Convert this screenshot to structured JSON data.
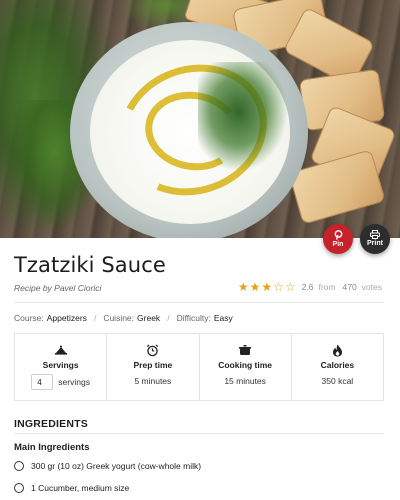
{
  "hero": {
    "alt_description": ""
  },
  "share": {
    "pin_label": "Pin",
    "pin_icon": "pinterest-icon",
    "print_label": "Print",
    "print_icon": "printer-icon",
    "pin_color": "#c7212b",
    "print_color": "#2d2d2d"
  },
  "recipe": {
    "title": "Tzatziki Sauce",
    "byline": "Recipe by Pavel Ciorici",
    "rating": {
      "value": 2.6,
      "value_text": "2.6",
      "from_text": "from",
      "votes_count": "470",
      "votes_text": "votes",
      "stars": [
        "full",
        "full",
        "full",
        "empty",
        "empty"
      ],
      "star_color": "#e6a117"
    },
    "meta": {
      "course_key": "Course:",
      "course_value": "Appetizers",
      "cuisine_key": "Cuisine:",
      "cuisine_value": "Greek",
      "difficulty_key": "Difficulty:",
      "difficulty_value": "Easy",
      "separator": "/"
    },
    "stats": {
      "servings_title": "Servings",
      "servings_value": "4",
      "servings_unit": "servings",
      "servings_icon": "servings-icon",
      "prep_title": "Prep time",
      "prep_value": "5 minutes",
      "prep_icon": "alarm-clock-icon",
      "cook_title": "Cooking time",
      "cook_value": "15 minutes",
      "cook_icon": "cooking-pot-icon",
      "calories_title": "Calories",
      "calories_value": "350 kcal",
      "calories_icon": "flame-icon"
    },
    "ingredients_heading": "INGREDIENTS",
    "ingredients_group": "Main Ingredients",
    "ingredients": [
      "300 gr (10 oz) Greek yogurt (cow-whole milk)",
      "1 Cucumber, medium size"
    ]
  }
}
